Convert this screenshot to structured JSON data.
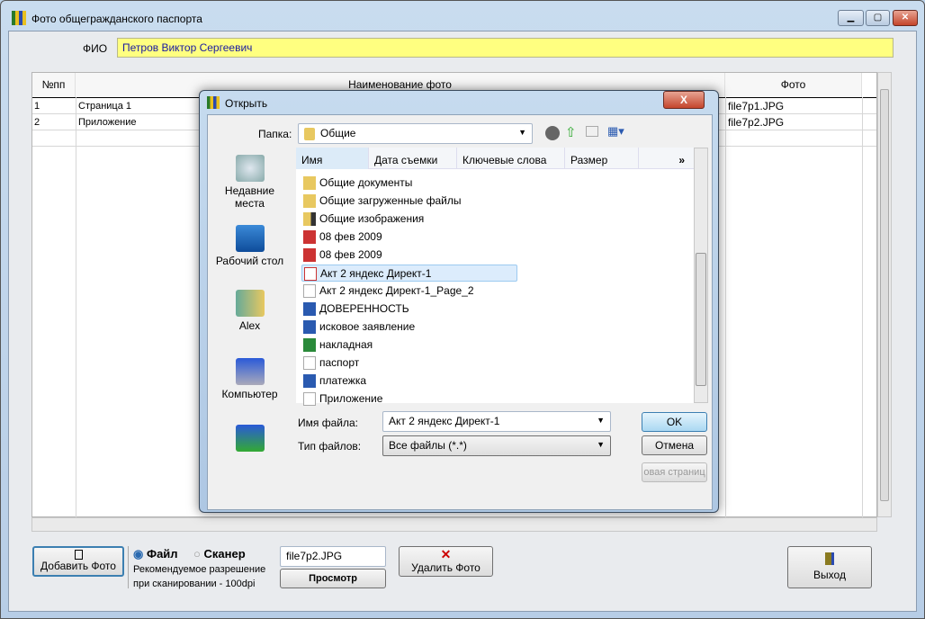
{
  "window": {
    "title": "Фото общегражданского паспорта",
    "min": "▁",
    "max": "▢",
    "close": "✕"
  },
  "fio": {
    "label": "ФИО",
    "value": "Петров Виктор Сергеевич"
  },
  "grid": {
    "columns": [
      "№пп",
      "Наименование фото",
      "Фото"
    ],
    "rows": [
      [
        "1",
        "Страница 1",
        "file7p1.JPG"
      ],
      [
        "2",
        "Приложение",
        "file7p2.JPG"
      ]
    ]
  },
  "dialog": {
    "title": "Открыть",
    "close": "X",
    "folder_label": "Папка:",
    "folder_value": "Общие",
    "places": [
      "Недавние места",
      "Рабочий стол",
      "Alex",
      "Компьютер",
      ""
    ],
    "columns": [
      "Имя",
      "Дата съемки",
      "Ключевые слова",
      "Размер",
      "»"
    ],
    "files": [
      {
        "name": "Общие документы",
        "icon": "folder"
      },
      {
        "name": "Общие загруженные файлы",
        "icon": "folder"
      },
      {
        "name": "Общие изображения",
        "icon": "folder-images"
      },
      {
        "name": "08 фев 2009",
        "icon": "mdf"
      },
      {
        "name": "08 фев 2009",
        "icon": "mds"
      },
      {
        "name": "Акт 2 яндекс Директ-1",
        "icon": "pdf"
      },
      {
        "name": "Акт 2 яндекс Директ-1_Page_2",
        "icon": "image"
      },
      {
        "name": "ДОВЕРЕННОСТЬ",
        "icon": "word"
      },
      {
        "name": "исковое заявление",
        "icon": "word"
      },
      {
        "name": "накладная",
        "icon": "excel"
      },
      {
        "name": "паспорт",
        "icon": "image"
      },
      {
        "name": "платежка",
        "icon": "word"
      },
      {
        "name": "Приложение",
        "icon": "image"
      }
    ],
    "selected_index": 5,
    "filename_label": "Имя файла:",
    "filename_value": "Акт 2 яндекс Директ-1",
    "filetype_label": "Тип файлов:",
    "filetype_value": "Все файлы (*.*)",
    "ok": "OK",
    "cancel": "Отмена",
    "extra": "овая страниц"
  },
  "bottom": {
    "add_photo": "Добавить Фото",
    "radio_file": "Файл",
    "radio_scanner": "Сканер",
    "hint1": "Рекомендуемое разрешение",
    "hint2": "при сканировании - 100dpi",
    "file_value": "file7p2.JPG",
    "preview": "Просмотр",
    "delete": "Удалить Фото",
    "delete_icon": "✕",
    "exit": "Выход"
  }
}
